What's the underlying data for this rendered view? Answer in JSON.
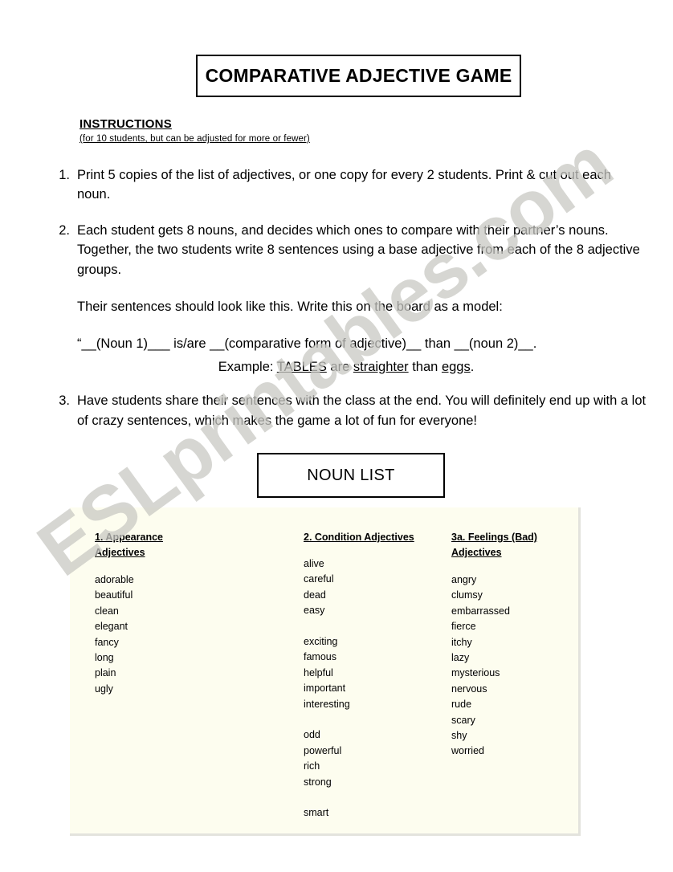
{
  "document": {
    "title": "COMPARATIVE ADJECTIVE GAME",
    "watermark": "ESLprintables.com"
  },
  "instructions": {
    "heading": "INSTRUCTIONS",
    "subheading": "(for 10 students, but can be adjusted for more or fewer)",
    "steps": [
      {
        "number": "1.",
        "paragraphs": [
          "Print 5 copies of the list of adjectives, or one copy for every 2 students. Print & cut out each noun."
        ]
      },
      {
        "number": "2.",
        "paragraphs": [
          "Each student gets 8 nouns, and decides which ones to compare with their partner’s nouns. Together, the two students write 8 sentences using a base adjective from each of the 8 adjective groups.",
          "Their sentences should look like this. Write this on the board as a model:"
        ],
        "model": "“__(Noun 1)___ is/are __(comparative form of adjective)__ than __(noun 2)__.",
        "example": {
          "prefix": "Example: ",
          "noun1": "TABLES",
          "middle": " are ",
          "adjective": "straighter",
          "conjunction": " than ",
          "noun2": "eggs",
          "suffix": "."
        }
      },
      {
        "number": "3.",
        "paragraphs": [
          "Have students share their sentences with the class at the end. You will definitely end up with a lot of crazy sentences, which makes the game a lot of fun for everyone!"
        ]
      }
    ]
  },
  "noun_list": {
    "label": "NOUN LIST",
    "panel_background": "#fdfdef",
    "columns": [
      {
        "heading_lines": [
          "1. Appearance",
          "Adjectives"
        ],
        "groups": [
          [
            "adorable",
            "beautiful",
            "clean",
            "elegant",
            "fancy",
            "long",
            "plain",
            "ugly"
          ]
        ]
      },
      {
        "heading_lines": [
          "2. Condition Adjectives"
        ],
        "groups": [
          [
            "alive",
            "careful",
            "dead",
            "easy"
          ],
          [
            "exciting",
            "famous",
            "helpful",
            "important",
            "interesting"
          ],
          [
            "odd",
            "powerful",
            "rich",
            "strong"
          ],
          [
            "smart"
          ]
        ]
      },
      {
        "heading_lines": [
          "3a. Feelings (Bad)",
          "Adjectives"
        ],
        "groups": [
          [
            "angry",
            "clumsy",
            "embarrassed",
            "fierce",
            "itchy",
            "lazy",
            "mysterious",
            "nervous",
            "rude",
            "scary",
            "shy",
            "worried"
          ]
        ]
      }
    ]
  }
}
